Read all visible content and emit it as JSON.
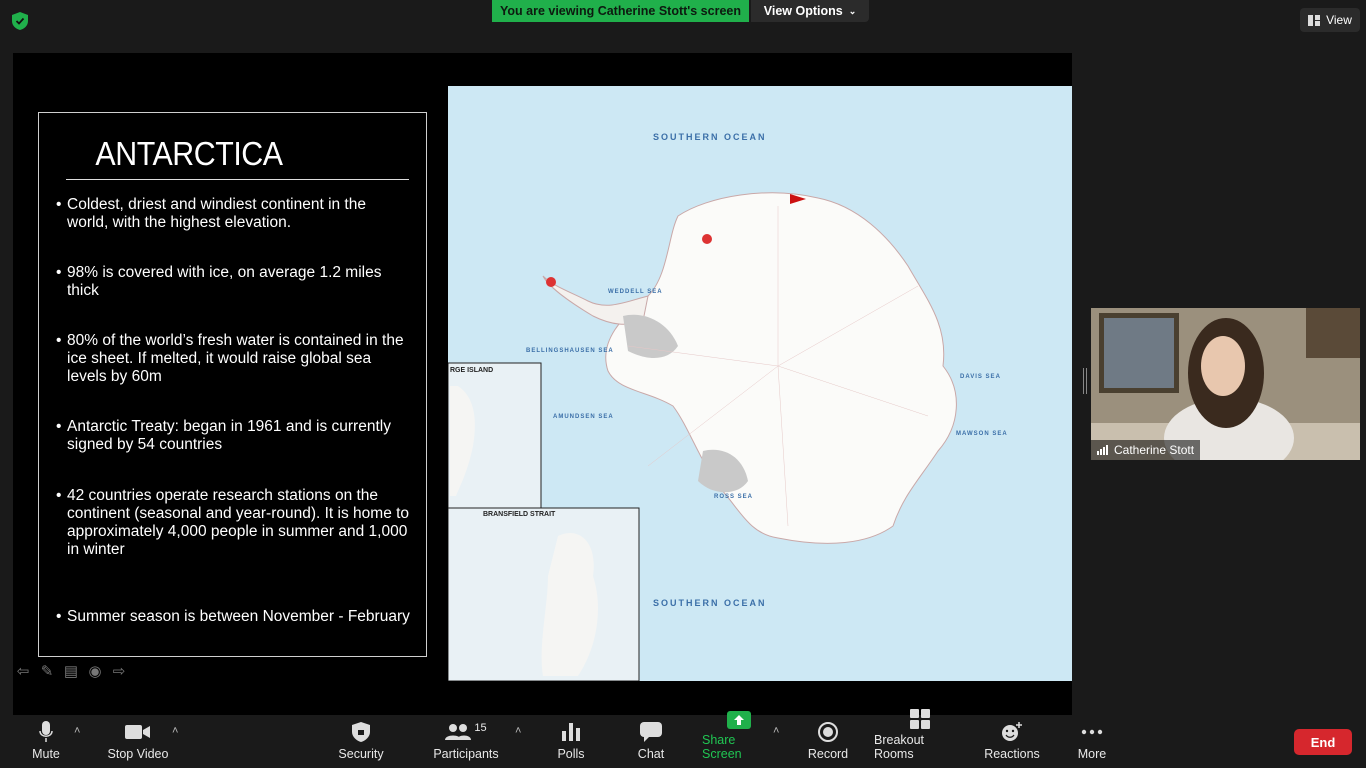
{
  "banner": {
    "viewing": "You are viewing Catherine Stott's screen",
    "view_options": "View Options"
  },
  "view_button": "View",
  "slide": {
    "title": "ANTARCTICA",
    "bullets": [
      "Coldest, driest and windiest continent in the world, with the highest elevation.",
      "98% is covered with ice, on average 1.2 miles thick",
      "80% of the world’s fresh water is contained in the ice sheet. If melted, it would raise global sea levels by 60m",
      "Antarctic Treaty: began in 1961 and is currently signed by 54 countries",
      "42 countries operate research  stations on the continent (seasonal and year-round).  It is home to approximately 4,000 people in summer and 1,000 in winter",
      "Summer season is between November - February"
    ]
  },
  "map": {
    "ocean_top": "SOUTHERN OCEAN",
    "ocean_bottom": "SOUTHERN OCEAN",
    "weddell": "WEDDELL SEA",
    "ross": "ROSS SEA",
    "amundsen": "AMUNDSEN SEA",
    "bellingshausen": "BELLINGSHAUSEN SEA",
    "davis": "DAVIS SEA",
    "mawson": "MAWSON SEA",
    "inset1": "RGE ISLAND",
    "inset2": "BRANSFIELD STRAIT"
  },
  "participant": {
    "name": "Catherine Stott"
  },
  "toolbar": {
    "mute": "Mute",
    "stop_video": "Stop Video",
    "security": "Security",
    "participants": "Participants",
    "participants_count": "15",
    "polls": "Polls",
    "chat": "Chat",
    "share_screen": "Share Screen",
    "record": "Record",
    "breakout": "Breakout Rooms",
    "reactions": "Reactions",
    "more": "More",
    "end": "End"
  },
  "colors": {
    "share_green": "#20b04b",
    "end_red": "#d6272d"
  }
}
